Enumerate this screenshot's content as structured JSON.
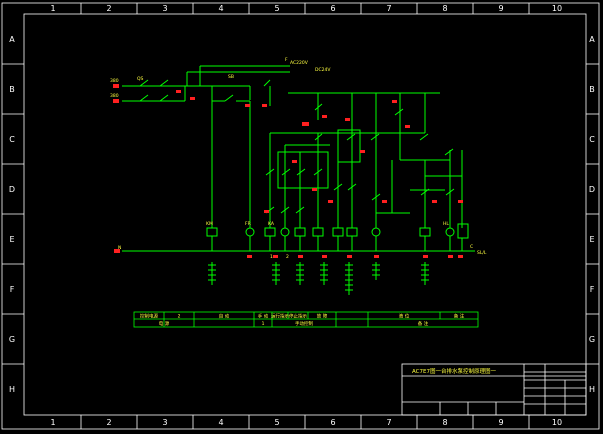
{
  "border": {
    "columns": [
      "1",
      "2",
      "3",
      "4",
      "5",
      "6",
      "7",
      "8",
      "9",
      "10"
    ],
    "rows": [
      "A",
      "B",
      "C",
      "D",
      "E",
      "F",
      "G",
      "H"
    ]
  },
  "title_block": {
    "title": "AC7E7图一台排水泵控制原理图一"
  },
  "labels": {
    "supply_l1": "380",
    "supply_l2": "380",
    "ac220": "AC220V",
    "dc24": "DC24V",
    "neutral": "N",
    "bus_tag": "F",
    "k_qs": "QS",
    "k_sb": "SB",
    "k_km": "KM",
    "k_fr": "FR",
    "k_ka": "KA",
    "k_hl": "HL",
    "k_lc": "C",
    "out_tag": "SL/L",
    "mid_row_a": "1",
    "mid_row_b": "2"
  },
  "table": {
    "row1": [
      "控制电源",
      "2",
      "自 动",
      "手 动",
      "运行指示",
      "停止指示",
      "故 障",
      "液 位",
      "备 注"
    ],
    "row2": [
      "电 源",
      "1",
      "手动控制",
      "",
      "",
      "",
      "",
      "",
      "备 注"
    ]
  },
  "colors": {
    "background": "#000000",
    "frame": "#ffffff",
    "wire": "#00ff00",
    "tag": "#ff2020",
    "label": "#ffff40",
    "accent": "#00ffff"
  }
}
